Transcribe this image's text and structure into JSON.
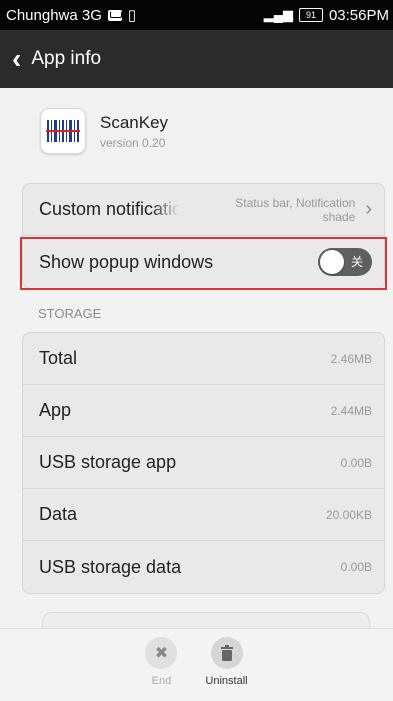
{
  "status_bar": {
    "carrier": "Chunghwa 3G",
    "signal": "3G",
    "battery": "91",
    "time": "03:56PM"
  },
  "title_bar": {
    "title": "App info"
  },
  "app": {
    "name": "ScanKey",
    "version": "version 0.20"
  },
  "settings": {
    "custom_notification_label": "Custom notifications",
    "custom_notification_value": "Status bar, Notification shade",
    "show_popup_label": "Show popup windows",
    "toggle_state_text": "关"
  },
  "storage": {
    "section_title": "STORAGE",
    "rows": [
      {
        "label": "Total",
        "value": "2.46MB"
      },
      {
        "label": "App",
        "value": "2.44MB"
      },
      {
        "label": "USB storage app",
        "value": "0.00B"
      },
      {
        "label": "Data",
        "value": "20.00KB"
      },
      {
        "label": "USB storage data",
        "value": "0.00B"
      }
    ]
  },
  "bottom_bar": {
    "end_label": "End",
    "uninstall_label": "Uninstall"
  },
  "colors": {
    "highlight": "#d1363a",
    "title_bg": "#2b2b2b",
    "status_bg": "#050505"
  }
}
